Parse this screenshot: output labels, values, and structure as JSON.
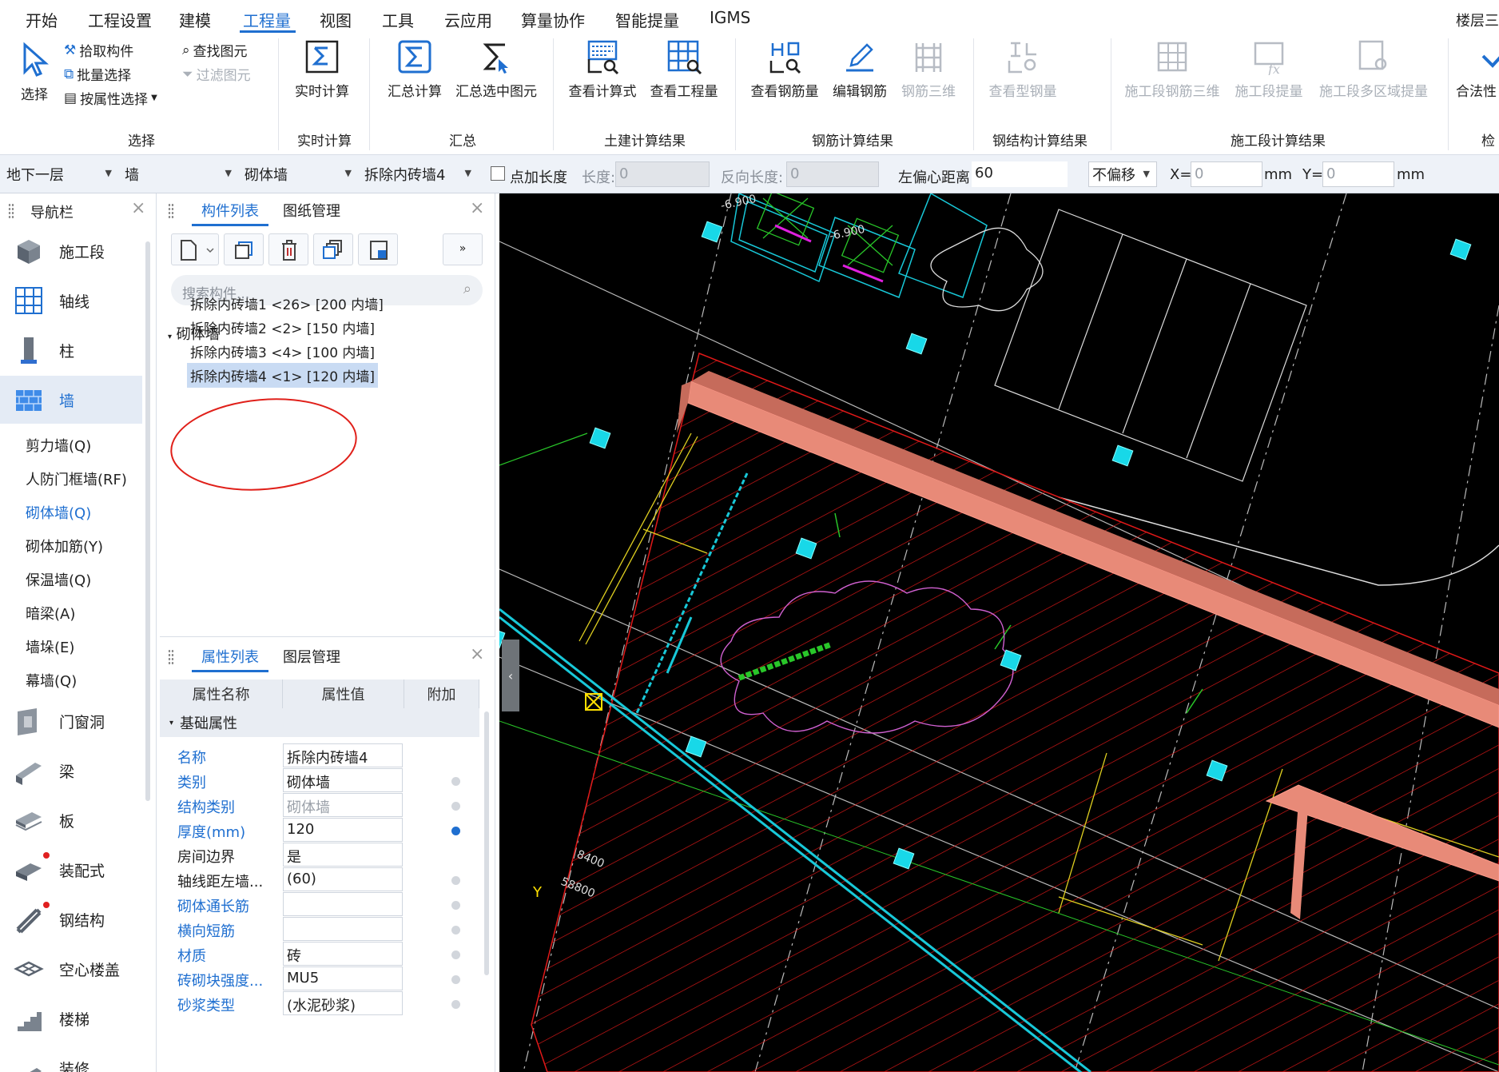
{
  "menu": [
    "开始",
    "工程设置",
    "建模",
    "工程量",
    "视图",
    "工具",
    "云应用",
    "算量协作",
    "智能提量",
    "IGMS"
  ],
  "floor_label": "楼层三",
  "ribbon": {
    "select": "选择",
    "pick": "拾取构件",
    "batch": "批量选择",
    "by_attr": "按属性选择",
    "find": "查找图元",
    "filter": "过滤图元",
    "realtime": "实时计算",
    "summary": "汇总计算",
    "summary_selected": "汇总选中图元",
    "view_formula": "查看计算式",
    "view_quantity": "查看工程量",
    "view_rebar": "查看钢筋量",
    "edit_rebar": "编辑钢筋",
    "rebar_3d": "钢筋三维",
    "view_steel": "查看型钢量",
    "stage_rebar_3d": "施工段钢筋三维",
    "stage_quantity": "施工段提量",
    "stage_multi": "施工段多区域提量",
    "legality": "合法性",
    "groups": [
      "选择",
      "实时计算",
      "汇总",
      "土建计算结果",
      "钢筋计算结果",
      "钢结构计算结果",
      "施工段计算结果",
      "检"
    ]
  },
  "propbar": {
    "floor": "地下一层",
    "category": "墙",
    "type": "砌体墙",
    "component": "拆除内砖墙4",
    "add_length": "点加长度",
    "length_label": "长度:",
    "length_value": "0",
    "rev_length_label": "反向长度:",
    "rev_length_value": "0",
    "offset_label": "左偏心距离:",
    "offset_value": "60",
    "offset_mode": "不偏移",
    "x_label": "X=",
    "x_value": "0",
    "y_label": "Y=",
    "y_value": "0",
    "unit": "mm"
  },
  "nav": {
    "title": "导航栏",
    "items": [
      "施工段",
      "轴线",
      "柱",
      "墙",
      "门窗洞",
      "梁",
      "板",
      "装配式",
      "钢结构",
      "空心楼盖",
      "楼梯",
      "装修"
    ],
    "sub": [
      "剪力墙(Q)",
      "人防门框墙(RF)",
      "砌体墙(Q)",
      "砌体加筋(Y)",
      "保温墙(Q)",
      "暗梁(A)",
      "墙垛(E)",
      "幕墙(Q)"
    ]
  },
  "complist": {
    "tabs": [
      "构件列表",
      "图纸管理"
    ],
    "search_placeholder": "搜索构件...",
    "group": "砌体墙",
    "items": [
      "拆除内砖墙1 <26> [200 内墙]",
      "拆除内砖墙2 <2> [150 内墙]",
      "拆除内砖墙3 <4> [100 内墙]",
      "拆除内砖墙4 <1> [120 内墙]"
    ]
  },
  "proplist": {
    "tabs": [
      "属性列表",
      "图层管理"
    ],
    "headers": [
      "属性名称",
      "属性值",
      "附加"
    ],
    "group": "基础属性",
    "rows": [
      {
        "name": "名称",
        "value": "拆除内砖墙4"
      },
      {
        "name": "类别",
        "value": "砌体墙"
      },
      {
        "name": "结构类别",
        "value": "砌体墙"
      },
      {
        "name": "厚度(mm)",
        "value": "120"
      },
      {
        "name": "房间边界",
        "value": "是"
      },
      {
        "name": "轴线距左墙...",
        "value": "(60)"
      },
      {
        "name": "砌体通长筋",
        "value": ""
      },
      {
        "name": "横向短筋",
        "value": ""
      },
      {
        "name": "材质",
        "value": "砖"
      },
      {
        "name": "砖砌块强度...",
        "value": "MU5"
      },
      {
        "name": "砂浆类型",
        "value": "(水泥砂浆)"
      }
    ]
  },
  "canvas": {
    "dim1": "8400",
    "dim2": "58800"
  }
}
